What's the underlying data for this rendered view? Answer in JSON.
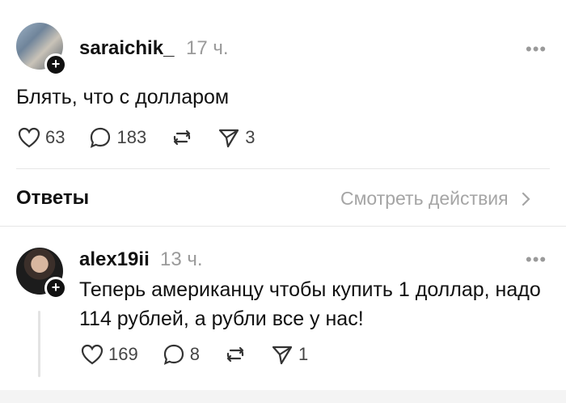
{
  "post": {
    "username": "saraichik_",
    "time": "17 ч.",
    "text": "Блять, что с долларом",
    "likes": "63",
    "comments": "183",
    "shares": "3",
    "more": "•••"
  },
  "replies_header": {
    "title": "Ответы",
    "link": "Смотреть действия"
  },
  "reply": {
    "username": "alex19ii",
    "time": "13 ч.",
    "text_line1": "Теперь американцу чтобы купить 1 доллар, надо",
    "text_line2": "114 рублей, а рубли все у нас!",
    "likes": "169",
    "comments": "8",
    "shares": "1",
    "more": "•••"
  },
  "icons": {
    "like": "heart-icon",
    "comment": "comment-bubble-icon",
    "repost": "repost-icon",
    "share": "send-icon",
    "more": "more-dots-icon",
    "follow": "plus-icon",
    "chevron": "chevron-right-icon"
  },
  "colors": {
    "text": "#111111",
    "muted": "#9a9a9a",
    "divider": "#e6e6e6"
  }
}
